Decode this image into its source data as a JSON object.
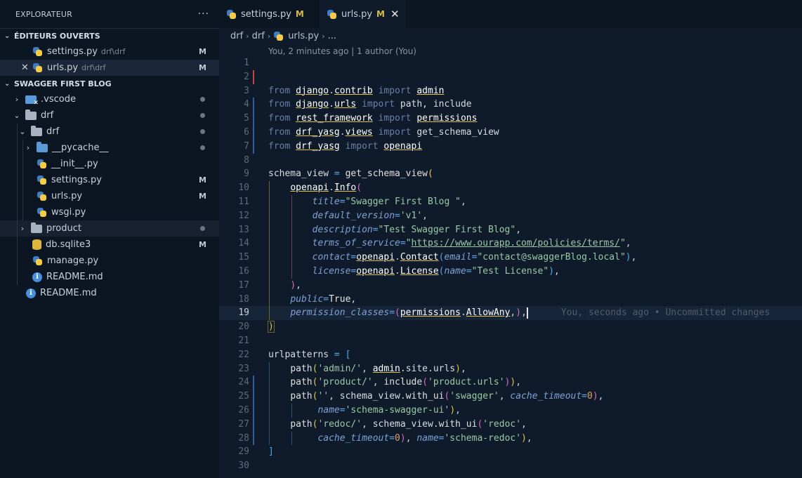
{
  "sidebar": {
    "title": "EXPLORATEUR",
    "more": "···",
    "open_editors": {
      "header": "ÉDITEURS OUVERTS",
      "items": [
        {
          "label": "settings.py",
          "path": "drf\\drf",
          "badge": "M"
        },
        {
          "label": "urls.py",
          "path": "drf\\drf",
          "badge": "M"
        }
      ]
    },
    "project": {
      "header": "SWAGGER FIRST BLOG",
      "items": [
        {
          "label": ".vscode",
          "kind": "folder"
        },
        {
          "label": "drf",
          "kind": "folder"
        },
        {
          "label": "drf",
          "kind": "folder"
        },
        {
          "label": "__pycache__",
          "kind": "folder"
        },
        {
          "label": "__init__.py",
          "kind": "python"
        },
        {
          "label": "settings.py",
          "kind": "python",
          "badge": "M"
        },
        {
          "label": "urls.py",
          "kind": "python",
          "badge": "M"
        },
        {
          "label": "wsgi.py",
          "kind": "python"
        },
        {
          "label": "product",
          "kind": "folder"
        },
        {
          "label": "db.sqlite3",
          "kind": "database",
          "badge": "M"
        },
        {
          "label": "manage.py",
          "kind": "python"
        },
        {
          "label": "README.md",
          "kind": "info"
        },
        {
          "label": "README.md",
          "kind": "info"
        }
      ]
    }
  },
  "tabs": [
    {
      "label": "settings.py",
      "badge": "M",
      "active": false
    },
    {
      "label": "urls.py",
      "badge": "M",
      "active": true,
      "close": "✕"
    }
  ],
  "breadcrumb": {
    "parts": [
      "drf",
      "drf",
      "urls.py",
      "..."
    ],
    "separator": "›"
  },
  "blame": "You, 2 minutes ago | 1 author (You)",
  "editor": {
    "line_numbers": [
      "1",
      "2",
      "3",
      "4",
      "5",
      "6",
      "7",
      "8",
      "9",
      "10",
      "11",
      "12",
      "13",
      "14",
      "15",
      "16",
      "17",
      "18",
      "19",
      "20",
      "21",
      "22",
      "23",
      "24",
      "25",
      "26",
      "27",
      "28",
      "29",
      "30"
    ],
    "inline_blame": "You, seconds ago • Uncommitted changes",
    "code": {
      "l3": [
        "from",
        "django",
        ".",
        "contrib",
        "import",
        "admin"
      ],
      "l4": [
        "from",
        "django",
        ".",
        "urls",
        "import",
        "path, include"
      ],
      "l5": [
        "from",
        "rest_framework",
        "import",
        "permissions"
      ],
      "l6": [
        "from",
        "drf_yasg",
        ".",
        "views",
        "import",
        "get_schema_view"
      ],
      "l7": [
        "from",
        "drf_yasg",
        "import",
        "openapi"
      ],
      "l9": [
        "schema_view",
        "=",
        "get_schema_view",
        "("
      ],
      "l10": [
        "openapi",
        ".",
        "Info",
        "("
      ],
      "l11": [
        "title",
        "=",
        "\"Swagger First Blog \"",
        ","
      ],
      "l12": [
        "default_version",
        "=",
        "'v1'",
        ","
      ],
      "l13": [
        "description",
        "=",
        "\"Test Swagger First Blog\"",
        ","
      ],
      "l14": [
        "terms_of_service",
        "=",
        "\"",
        "https://www.ourapp.com/policies/terms/",
        "\"",
        ","
      ],
      "l15": [
        "contact",
        "=",
        "openapi",
        ".",
        "Contact",
        "(",
        "email",
        "=",
        "\"contact@swaggerBlog.local\"",
        ")",
        ","
      ],
      "l16": [
        "license",
        "=",
        "openapi",
        ".",
        "License",
        "(",
        "name",
        "=",
        "\"Test License\"",
        ")",
        ","
      ],
      "l17": [
        ")",
        ","
      ],
      "l18": [
        "public",
        "=",
        "True",
        ","
      ],
      "l19": [
        "permission_classes",
        "=",
        "(",
        "permissions",
        ".",
        "AllowAny",
        ",",
        ")",
        ","
      ],
      "l20": [
        ")"
      ],
      "l22": [
        "urlpatterns",
        "=",
        "["
      ],
      "l23": [
        "path",
        "(",
        "'admin/'",
        ", ",
        "admin",
        ".site.urls",
        ")",
        ","
      ],
      "l24": [
        "path",
        "(",
        "'product/'",
        ", ",
        "include",
        "(",
        "'product.urls'",
        ")",
        ")",
        ","
      ],
      "l25": [
        "path",
        "(",
        "''",
        ", ",
        "schema_view",
        ".",
        "with_ui",
        "(",
        "'swagger'",
        ", ",
        "cache_timeout",
        "=",
        "0",
        ")",
        ","
      ],
      "l26": [
        "name",
        "=",
        "'schema-swagger-ui'",
        ")",
        ","
      ],
      "l27": [
        "path",
        "(",
        "'redoc/'",
        ", ",
        "schema_view",
        ".",
        "with_ui",
        "(",
        "'redoc'",
        ","
      ],
      "l28": [
        "cache_timeout",
        "=",
        "0",
        ")",
        ", ",
        "name",
        "=",
        "'schema-redoc'",
        ")",
        ","
      ],
      "l29": [
        "]"
      ]
    }
  }
}
